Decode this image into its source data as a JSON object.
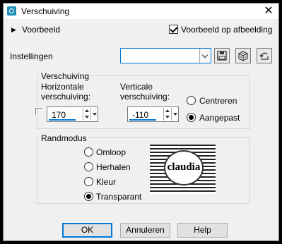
{
  "window": {
    "title": "Verschuiving"
  },
  "preview_toggle": {
    "label": "Voorbeeld"
  },
  "preview_on_image": {
    "label": "Voorbeeld op afbeelding",
    "checked": true
  },
  "settings": {
    "label": "Instellingen",
    "value": ""
  },
  "shift_group": {
    "label": "Verschuiving",
    "horizontal": {
      "label_line1": "Horizontale",
      "label_line2": "verschuiving:",
      "value": "170"
    },
    "vertical": {
      "label_line1": "Verticale",
      "label_line2": "verschuiving:",
      "value": "-110"
    },
    "center": {
      "label": "Centreren",
      "selected": false
    },
    "custom": {
      "label": "Aangepast",
      "selected": true
    }
  },
  "edge_mode": {
    "label": "Randmodus",
    "options": [
      {
        "label": "Omloop",
        "selected": false
      },
      {
        "label": "Herhalen",
        "selected": false
      },
      {
        "label": "Kleur",
        "selected": false
      },
      {
        "label": "Transparant",
        "selected": true
      }
    ],
    "preview_text": "claudia"
  },
  "buttons": {
    "ok": "OK",
    "cancel": "Annuleren",
    "help": "Help"
  },
  "colors": {
    "accent": "#0078d7",
    "background": "#f0f0f0"
  }
}
